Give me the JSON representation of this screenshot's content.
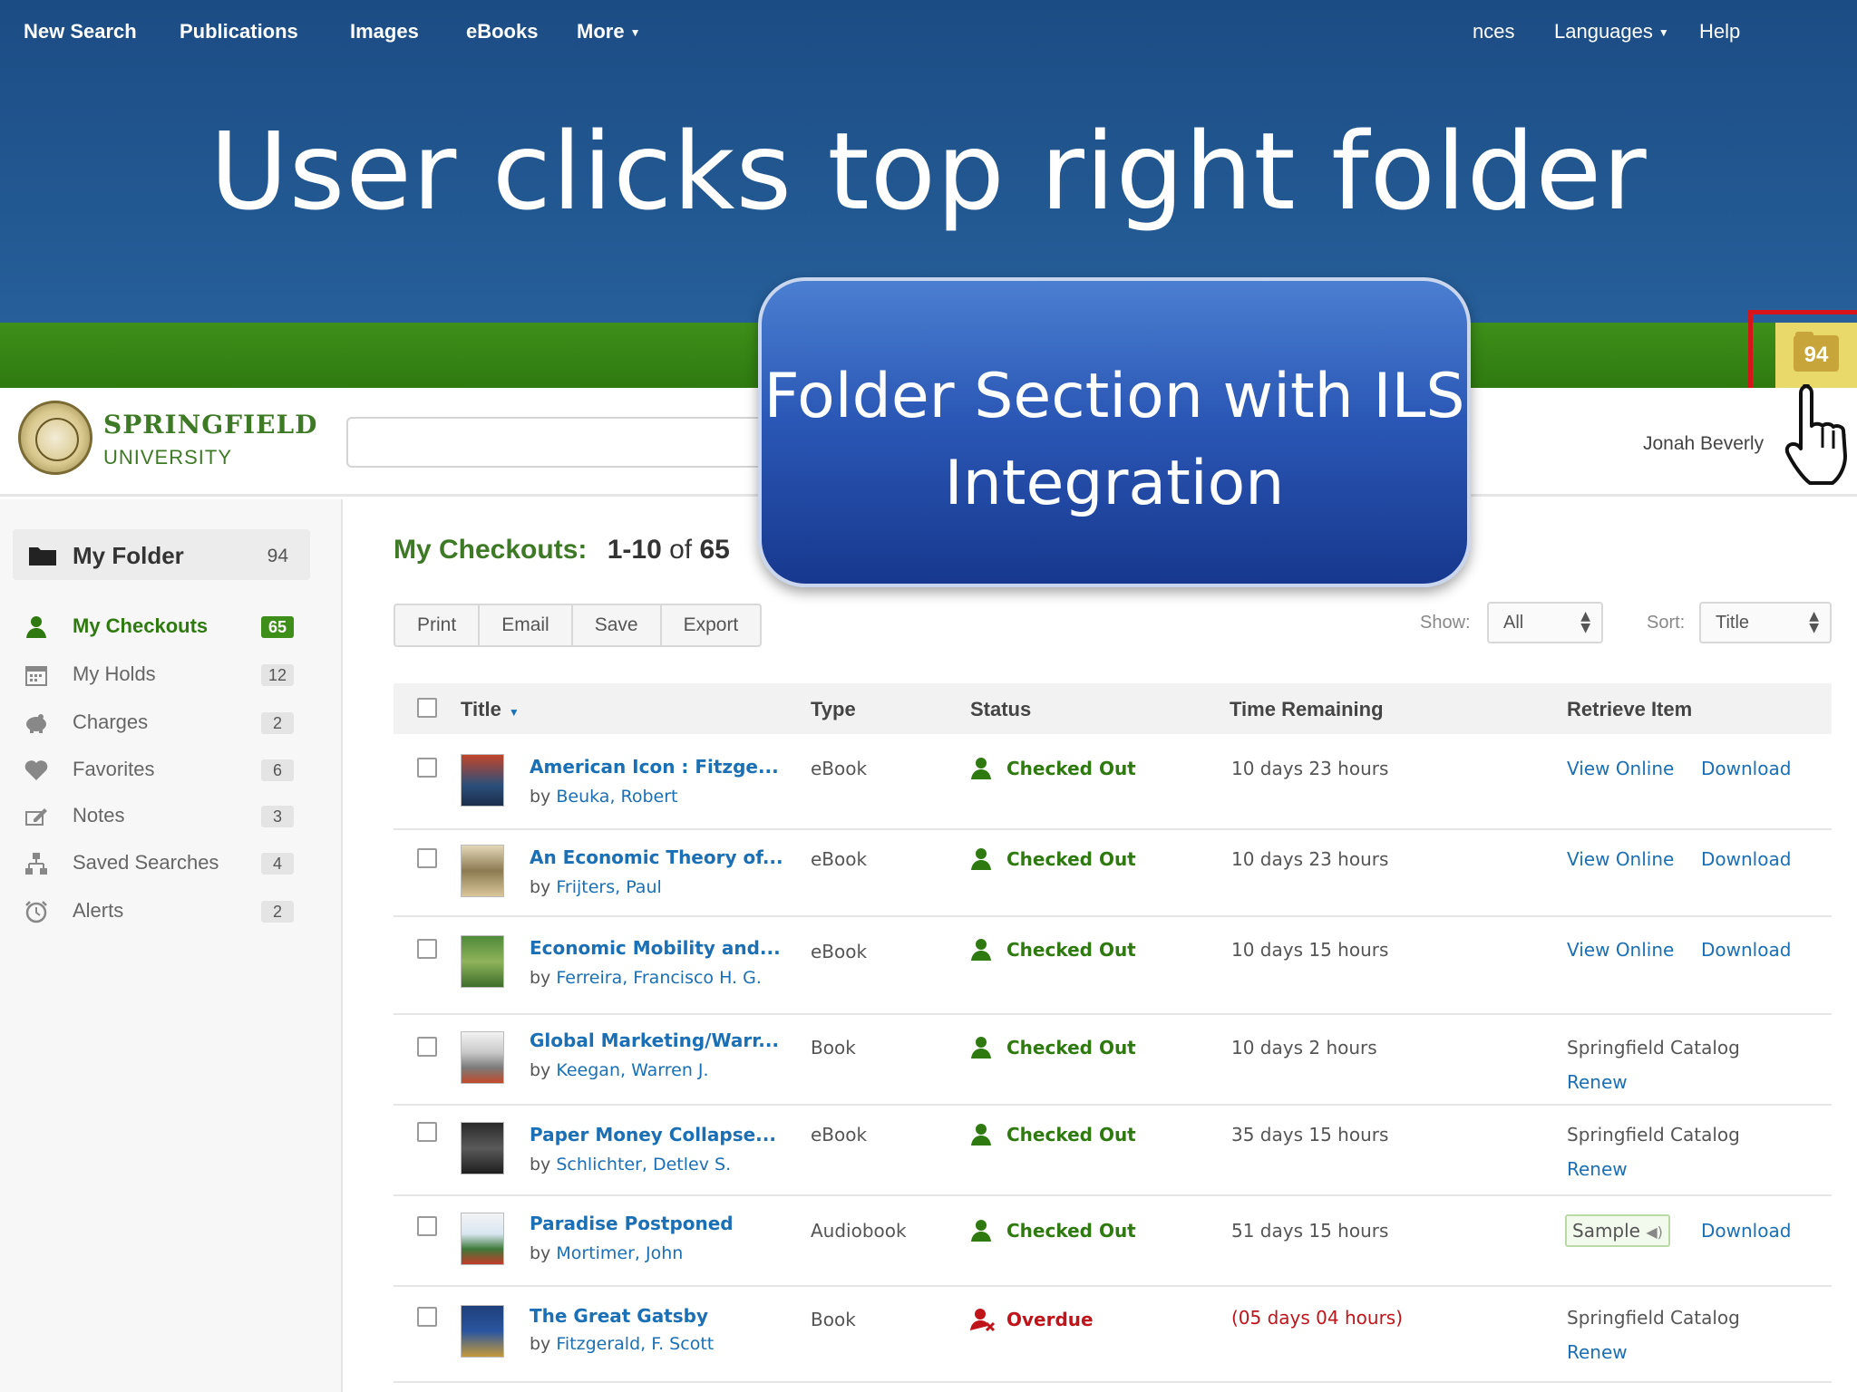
{
  "slide": {
    "title": "User clicks top right folder",
    "callout": "Folder Section with ILS Integration"
  },
  "nav": {
    "items": [
      "New Search",
      "Publications",
      "Images",
      "eBooks",
      "More"
    ],
    "right_items": [
      "nces",
      "Languages",
      "Help"
    ],
    "folder_count": "94"
  },
  "colors": {
    "nav_green": "#3e8f1a",
    "link_blue": "#1a6fb5",
    "banner_blue": "#1c4c84",
    "overdue_red": "#c0141b",
    "highlight_red": "#d8141b"
  },
  "header": {
    "brand_line1": "SPRINGFIELD",
    "brand_line2": "UNIVERSITY",
    "search_value": "",
    "user_name": "Jonah Beverly"
  },
  "sidebar": {
    "folder_label": "My Folder",
    "folder_count": "94",
    "items": [
      {
        "label": "My Checkouts",
        "count": "65",
        "icon": "user-checkout-icon"
      },
      {
        "label": "My Holds",
        "count": "12",
        "icon": "calendar-icon"
      },
      {
        "label": "Charges",
        "count": "2",
        "icon": "piggy-bank-icon"
      },
      {
        "label": "Favorites",
        "count": "6",
        "icon": "heart-icon"
      },
      {
        "label": "Notes",
        "count": "3",
        "icon": "notes-icon"
      },
      {
        "label": "Saved Searches",
        "count": "4",
        "icon": "hierarchy-icon"
      },
      {
        "label": "Alerts",
        "count": "2",
        "icon": "alarm-clock-icon"
      }
    ]
  },
  "main": {
    "heading": "My Checkouts:",
    "range": "1-10",
    "of": "of",
    "total": "65",
    "actions": [
      "Print",
      "Email",
      "Save",
      "Export"
    ],
    "show_label": "Show:",
    "show_value": "All",
    "sort_label": "Sort:",
    "sort_value": "Title"
  },
  "table": {
    "columns": [
      "Title",
      "Type",
      "Status",
      "Time Remaining",
      "Retrieve Item"
    ],
    "rows": [
      {
        "title": "American Icon : Fitzge...",
        "by": "by",
        "author": "Beuka, Robert",
        "type": "eBook",
        "status": "Checked Out",
        "remaining": "10 days 23 hours",
        "retrieve": [
          "View Online",
          "Download"
        ]
      },
      {
        "title": "An Economic Theory of...",
        "by": "by",
        "author": "Frijters, Paul",
        "type": "eBook",
        "status": "Checked Out",
        "remaining": "10 days 23 hours",
        "retrieve": [
          "View Online",
          "Download"
        ]
      },
      {
        "title": "Economic Mobility and...",
        "by": "by",
        "author": "Ferreira, Francisco H. G.",
        "type": "eBook",
        "status": "Checked Out",
        "remaining": "10 days  15 hours",
        "retrieve": [
          "View Online",
          "Download"
        ]
      },
      {
        "title": "Global Marketing/Warr...",
        "by": "by",
        "author": "Keegan, Warren J.",
        "type": "Book",
        "status": "Checked Out",
        "remaining": "10 days  2 hours",
        "retrieve": [
          "Springfield Catalog",
          "Renew"
        ]
      },
      {
        "title": "Paper Money Collapse...",
        "by": "by",
        "author": "Schlichter, Detlev S.",
        "type": "eBook",
        "status": "Checked Out",
        "remaining": "35 days  15 hours",
        "retrieve": [
          "Springfield Catalog",
          "Renew"
        ]
      },
      {
        "title": "Paradise Postponed",
        "by": "by",
        "author": "Mortimer, John",
        "type": "Audiobook",
        "status": "Checked Out",
        "remaining": "51 days 15 hours",
        "retrieve": [
          "Sample",
          "Download"
        ]
      },
      {
        "title": "The Great Gatsby",
        "by": "by",
        "author": "Fitzgerald, F. Scott",
        "type": "Book",
        "status": "Overdue",
        "remaining": "(05 days  04 hours)",
        "retrieve": [
          "Springfield Catalog",
          "Renew"
        ]
      }
    ]
  }
}
